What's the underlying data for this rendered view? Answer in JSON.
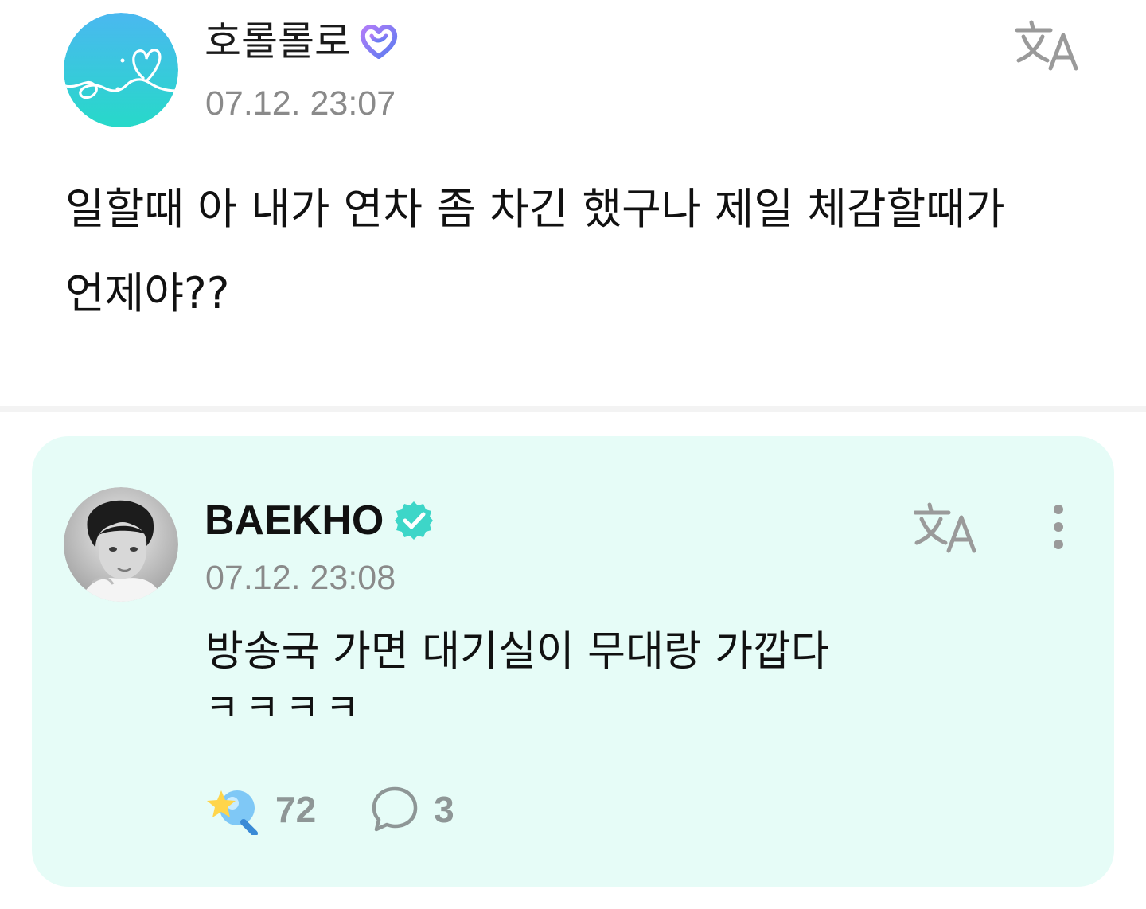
{
  "post": {
    "author": "호롤롤로",
    "timestamp": "07.12. 23:07",
    "body_line1": "일할때 아 내가 연차 좀 차긴 했구나 제일 체감할때가",
    "body_line2": "언제야??"
  },
  "reply": {
    "author": "BAEKHO",
    "timestamp": "07.12. 23:08",
    "body_line1": "방송국 가면 대기실이 무대랑 가깝다",
    "body_line2": "ㅋㅋㅋㅋ",
    "like_count": "72",
    "comment_count": "3"
  },
  "colors": {
    "reply_card_bg": "#e6fcf7",
    "verified_badge": "#3dd6c8",
    "membership_badge": "#8a6cf7",
    "timestamp": "#8a8a8a",
    "icon_gray": "#9a9a9a"
  },
  "icons": {
    "post_avatar": "heart-doodle-avatar",
    "membership_badge": "heart-badge-icon",
    "translate": "translate-icon",
    "verified": "verified-badge-icon",
    "more": "more-vertical-icon",
    "like": "star-lightstick-icon",
    "comment": "comment-bubble-icon"
  }
}
